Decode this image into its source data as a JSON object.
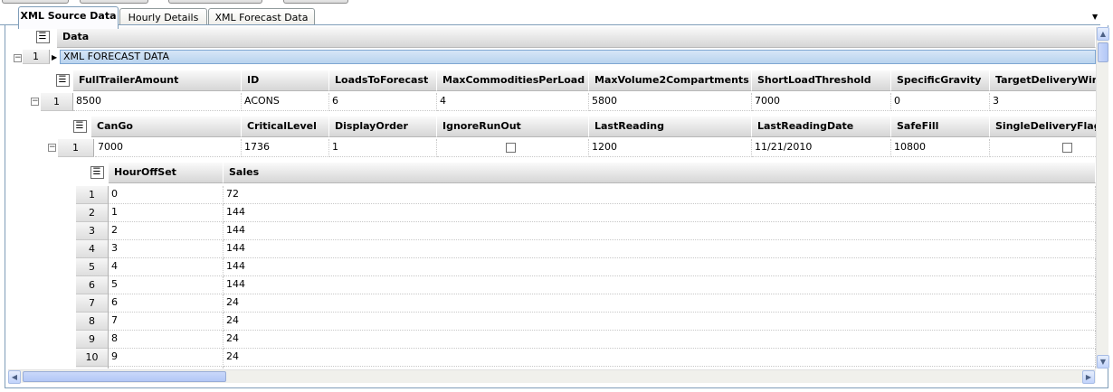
{
  "tabs": [
    "XML Source Data",
    "Hourly Details",
    "XML Forecast Data"
  ],
  "band0": {
    "header": "Data"
  },
  "group": {
    "row_number": "1",
    "label": "XML FORECAST DATA"
  },
  "band1": {
    "columns": [
      "FullTrailerAmount",
      "ID",
      "LoadsToForecast",
      "MaxCommoditiesPerLoad",
      "MaxVolume2Compartments",
      "ShortLoadThreshold",
      "SpecificGravity",
      "TargetDeliveryWindow"
    ],
    "row_number": "1",
    "row": [
      "8500",
      "ACONS",
      "6",
      "4",
      "5800",
      "7000",
      "0",
      "3"
    ]
  },
  "band2": {
    "columns": [
      "CanGo",
      "CriticalLevel",
      "DisplayOrder",
      "IgnoreRunOut",
      "LastReading",
      "LastReadingDate",
      "SafeFill",
      "SingleDeliveryFlag"
    ],
    "row_number": "1",
    "row": [
      "7000",
      "1736",
      "1",
      "",
      "1200",
      "11/21/2010",
      "10800",
      ""
    ]
  },
  "band3": {
    "columns": [
      "HourOffSet",
      "Sales"
    ],
    "rows": [
      [
        "1",
        "0",
        "72"
      ],
      [
        "2",
        "1",
        "144"
      ],
      [
        "3",
        "2",
        "144"
      ],
      [
        "4",
        "3",
        "144"
      ],
      [
        "5",
        "4",
        "144"
      ],
      [
        "6",
        "5",
        "144"
      ],
      [
        "7",
        "6",
        "24"
      ],
      [
        "8",
        "7",
        "24"
      ],
      [
        "9",
        "8",
        "24"
      ],
      [
        "10",
        "9",
        "24"
      ]
    ]
  },
  "colors": {
    "header_bg": "#e4e4e4",
    "group_bar": "#b9d3ee",
    "tab_border": "#7f9db9"
  }
}
